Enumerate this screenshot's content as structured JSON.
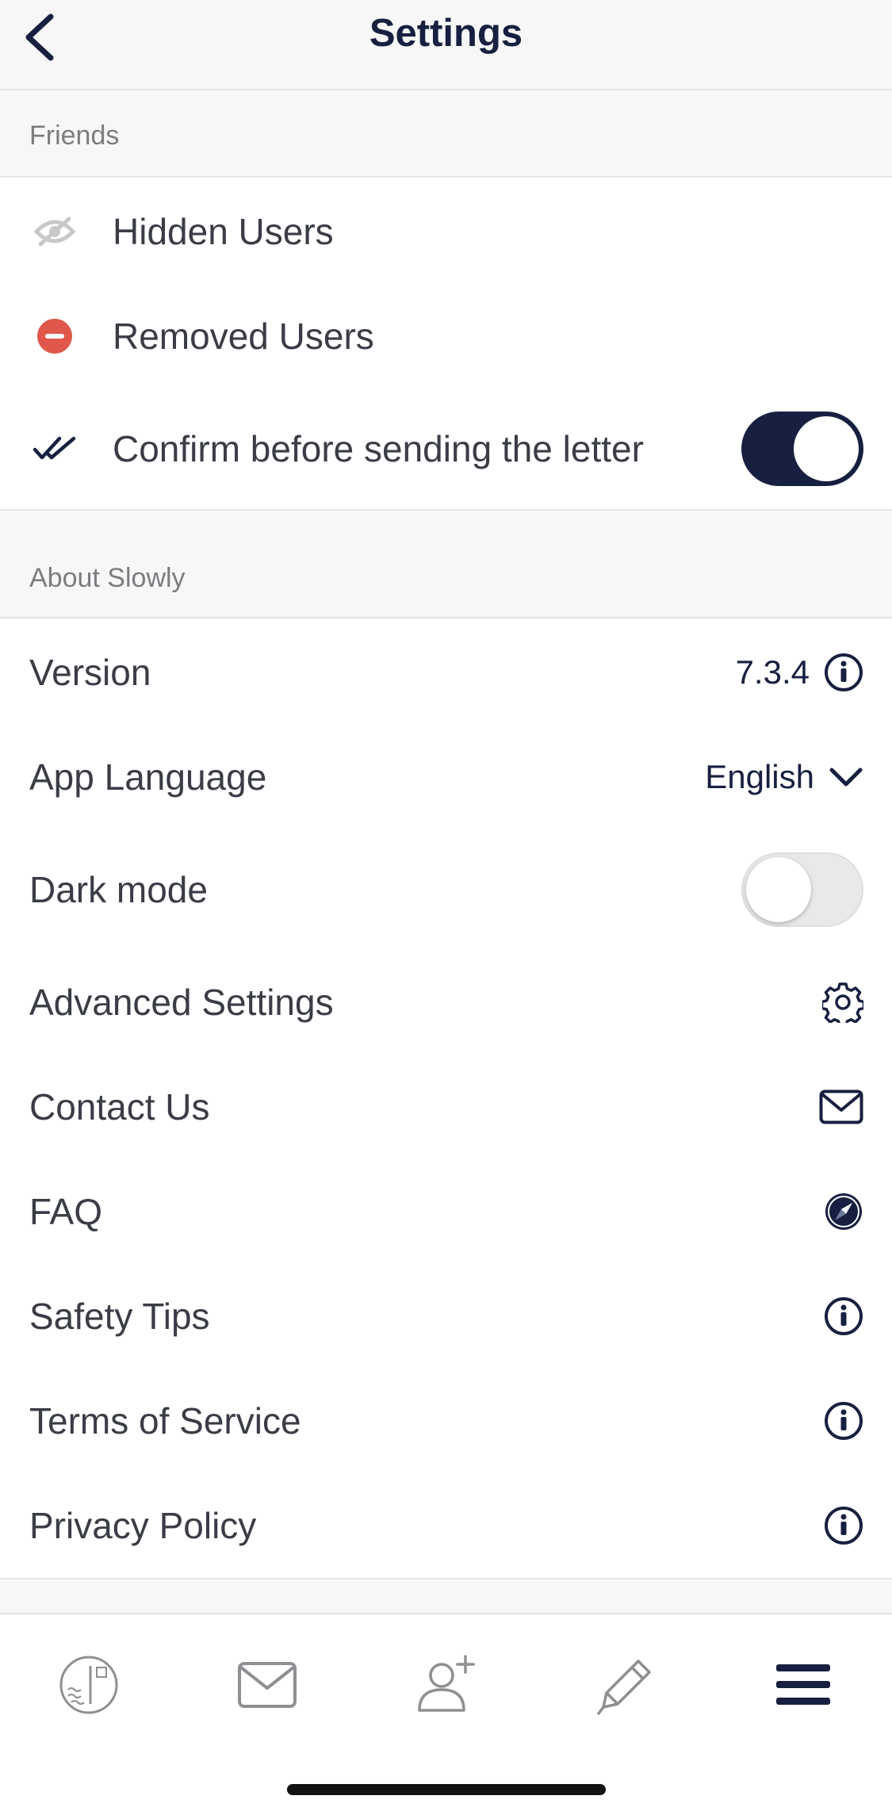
{
  "header": {
    "title": "Settings",
    "back_icon": "chevron-left-icon"
  },
  "friends_section": {
    "title": "Friends",
    "items": [
      {
        "label": "Hidden Users",
        "icon": "eye-slash-icon"
      },
      {
        "label": "Removed Users",
        "icon": "minus-circle-icon"
      },
      {
        "label": "Confirm before sending the letter",
        "icon": "double-check-icon",
        "toggle_on": true
      }
    ]
  },
  "about_section": {
    "title": "About Slowly",
    "version": {
      "label": "Version",
      "value": "7.3.4",
      "icon": "info-icon"
    },
    "language": {
      "label": "App Language",
      "value": "English",
      "icon": "chevron-down-icon"
    },
    "dark_mode": {
      "label": "Dark mode",
      "toggle_on": false
    },
    "advanced": {
      "label": "Advanced Settings",
      "icon": "gear-icon"
    },
    "contact": {
      "label": "Contact Us",
      "icon": "envelope-icon"
    },
    "faq": {
      "label": "FAQ",
      "icon": "compass-icon"
    },
    "safety": {
      "label": "Safety Tips",
      "icon": "info-icon"
    },
    "terms": {
      "label": "Terms of Service",
      "icon": "info-icon"
    },
    "privacy": {
      "label": "Privacy Policy",
      "icon": "info-icon"
    }
  },
  "tabbar": {
    "tabs": [
      {
        "icon": "stamp-icon"
      },
      {
        "icon": "envelope-icon"
      },
      {
        "icon": "add-friend-icon"
      },
      {
        "icon": "pencil-icon"
      },
      {
        "icon": "menu-icon",
        "active": true
      }
    ]
  },
  "colors": {
    "navy": "#172040",
    "removed_red": "#e0574b",
    "text": "#3a3d45",
    "section_bg": "#f7f7f7"
  }
}
